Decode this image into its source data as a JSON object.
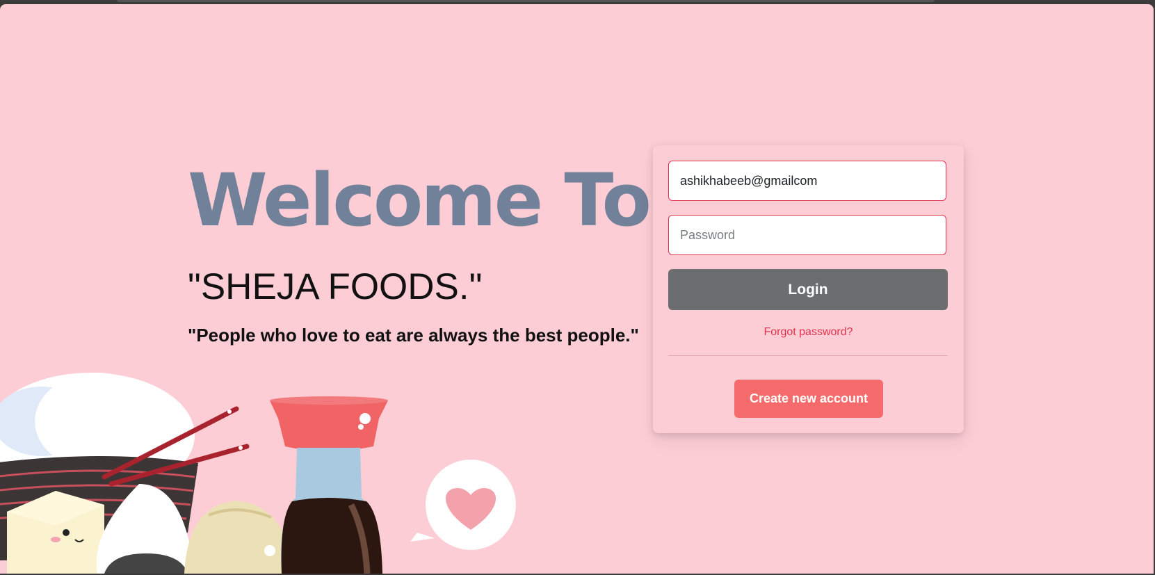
{
  "hero": {
    "title": "Welcome To",
    "brand": "\"SHEJA FOODS.\"",
    "quote": "\"People who love to eat are always the best people.\""
  },
  "login": {
    "email_value": "ashikhabeeb@gmailcom",
    "password_placeholder": "Password",
    "login_label": "Login",
    "forgot_label": "Forgot password?",
    "create_label": "Create new account"
  },
  "colors": {
    "background": "#fdcdd6",
    "title": "#718199",
    "accent": "#e0344d",
    "login_button": "#6c6d6f",
    "create_button": "#f56b6b"
  },
  "illustration": {
    "icons": [
      "rice-bowl-icon",
      "chopsticks-icon",
      "tofu-icon",
      "onigiri-icon",
      "dumpling-icon",
      "soy-sauce-bottle-icon",
      "heart-speech-bubble-icon"
    ]
  }
}
